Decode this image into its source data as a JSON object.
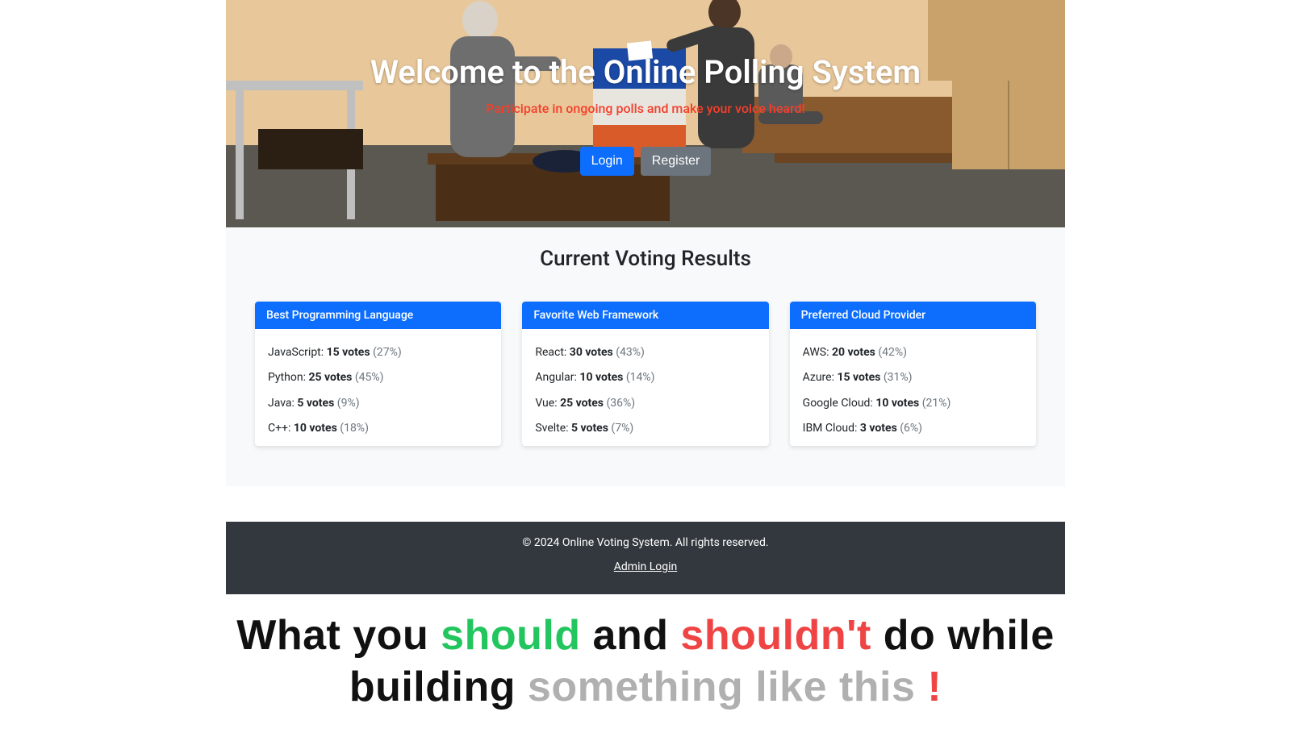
{
  "hero": {
    "title": "Welcome to the Online Polling System",
    "subtitle": "Participate in ongoing polls and make your voice heard!",
    "login": "Login",
    "register": "Register"
  },
  "results": {
    "heading": "Current Voting Results",
    "polls": [
      {
        "title": "Best Programming Language",
        "options": [
          {
            "label": "JavaScript",
            "votes": 15,
            "pct": 27
          },
          {
            "label": "Python",
            "votes": 25,
            "pct": 45
          },
          {
            "label": "Java",
            "votes": 5,
            "pct": 9
          },
          {
            "label": "C++",
            "votes": 10,
            "pct": 18
          }
        ]
      },
      {
        "title": "Favorite Web Framework",
        "options": [
          {
            "label": "React",
            "votes": 30,
            "pct": 43
          },
          {
            "label": "Angular",
            "votes": 10,
            "pct": 14
          },
          {
            "label": "Vue",
            "votes": 25,
            "pct": 36
          },
          {
            "label": "Svelte",
            "votes": 5,
            "pct": 7
          }
        ]
      },
      {
        "title": "Preferred Cloud Provider",
        "options": [
          {
            "label": "AWS",
            "votes": 20,
            "pct": 42
          },
          {
            "label": "Azure",
            "votes": 15,
            "pct": 31
          },
          {
            "label": "Google Cloud",
            "votes": 10,
            "pct": 21
          },
          {
            "label": "IBM Cloud",
            "votes": 3,
            "pct": 6
          }
        ]
      }
    ]
  },
  "footer": {
    "copyright": "© 2024 Online Voting System. All rights reserved.",
    "admin": "Admin Login"
  },
  "caption": {
    "w1": "What you ",
    "w2": "should",
    "w3": " and ",
    "w4": "shouldn't",
    "w5": " do while",
    "w6": "building ",
    "w7": "something like this ",
    "w8": "!"
  }
}
